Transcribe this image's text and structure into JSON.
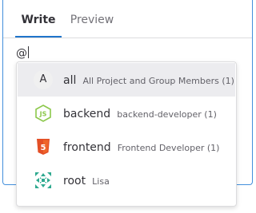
{
  "tabs": [
    {
      "label": "Write",
      "active": true
    },
    {
      "label": "Preview",
      "active": false
    }
  ],
  "editor": {
    "value": "@"
  },
  "dropdown": {
    "items": [
      {
        "avatar_letter": "A",
        "name": "all",
        "description": "All Project and Group Members (1)",
        "icon": "avatar-letter-icon",
        "active": true
      },
      {
        "name": "backend",
        "description": "backend-developer (1)",
        "icon": "nodejs-icon",
        "active": false
      },
      {
        "name": "frontend",
        "description": "Frontend Developer (1)",
        "icon": "html5-icon",
        "active": false
      },
      {
        "name": "root",
        "description": "Lisa",
        "icon": "identicon-icon",
        "active": false
      }
    ]
  },
  "colors": {
    "accent": "#1f75cb",
    "focus_border": "#428fdc",
    "active_row": "#ececef",
    "nodejs_green": "#8cc84b",
    "html5_orange": "#e34f26",
    "identicon_teal": "#2ea98f"
  }
}
